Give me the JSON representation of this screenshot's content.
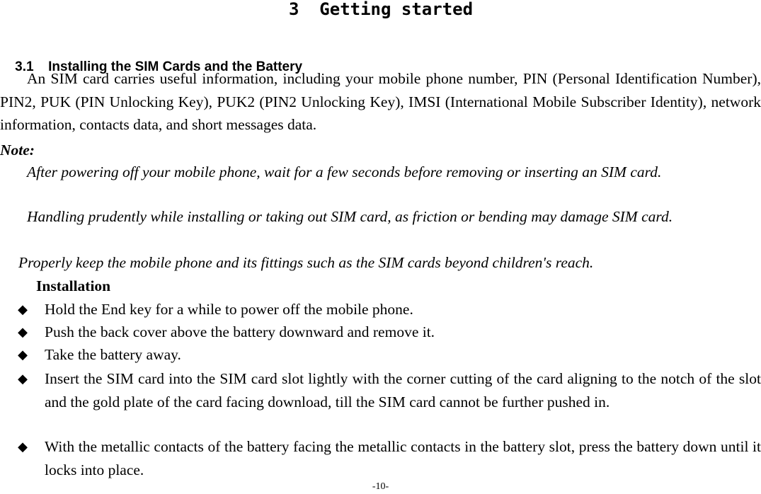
{
  "chapter": {
    "title": "3  Getting started"
  },
  "section": {
    "number": "3.1",
    "title": "Installing the SIM Cards and the Battery"
  },
  "intro_paragraph": "An SIM card carries useful information, including your mobile phone number, PIN (Personal Identification Number), PIN2, PUK (PIN Unlocking Key), PUK2 (PIN2 Unlocking Key), IMSI (International Mobile Subscriber Identity), network information, contacts data, and short messages data.",
  "note": {
    "label": "Note:",
    "items": [
      "After powering off your mobile phone, wait for a few seconds before removing or inserting an SIM card.",
      "Handling prudently while installing or taking out SIM card, as friction or bending may damage SIM card.",
      "Properly keep the mobile phone and its fittings such as the SIM cards beyond children's reach."
    ]
  },
  "installation": {
    "heading": "Installation",
    "bullet_icon": "black-diamond",
    "bullet_glyph": "◆",
    "steps": [
      "Hold the End key for a while to power off the mobile phone.",
      "Push the back cover above the battery downward and remove it.",
      "Take the battery away.",
      "Insert the SIM card into the SIM card slot lightly with the corner cutting of the card aligning to the notch of the slot and the gold plate of the card facing download, till the SIM card cannot be further pushed in.",
      "With the metallic contacts of the battery facing the metallic contacts in the battery slot, press the battery down until it locks into place."
    ]
  },
  "footer": {
    "page_number": "-10-"
  }
}
